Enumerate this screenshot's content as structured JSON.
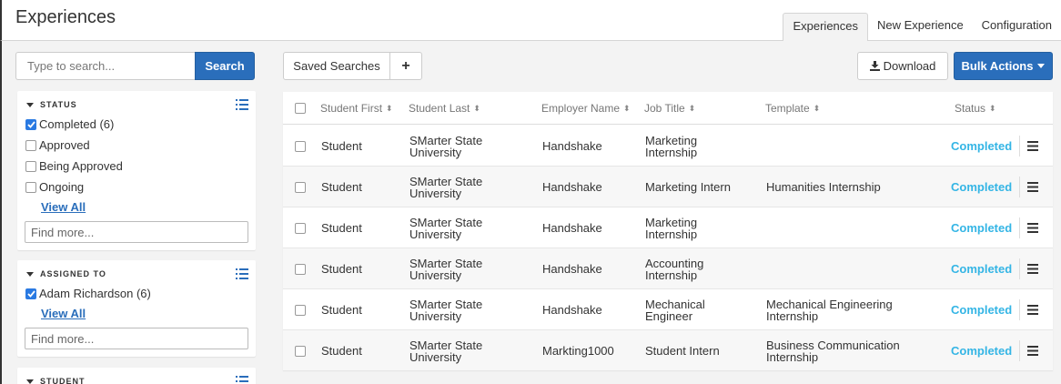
{
  "header": {
    "title": "Experiences",
    "tabs": [
      {
        "label": "Experiences",
        "active": true
      },
      {
        "label": "New Experience",
        "active": false
      },
      {
        "label": "Configuration",
        "active": false
      }
    ]
  },
  "sidebar": {
    "search_placeholder": "Type to search...",
    "search_button": "Search",
    "status": {
      "heading": "STATUS",
      "options": [
        {
          "label": "Completed (6)",
          "checked": true
        },
        {
          "label": "Approved",
          "checked": false
        },
        {
          "label": "Being Approved",
          "checked": false
        },
        {
          "label": "Ongoing",
          "checked": false
        }
      ],
      "view_all": "View All",
      "find_placeholder": "Find more..."
    },
    "assigned_to": {
      "heading": "ASSIGNED TO",
      "options": [
        {
          "label": "Adam Richardson (6)",
          "checked": true
        }
      ],
      "view_all": "View All",
      "find_placeholder": "Find more..."
    },
    "student": {
      "heading": "STUDENT"
    }
  },
  "toolbar": {
    "saved_searches": "Saved Searches",
    "add": "+",
    "download": "Download",
    "bulk_actions": "Bulk Actions"
  },
  "table": {
    "columns": [
      "Student First",
      "Student Last",
      "Employer Name",
      "Job Title",
      "Template",
      "Status"
    ],
    "rows": [
      {
        "first": "Student",
        "last": "SMarter State University",
        "employer": "Handshake",
        "job": "Marketing Internship",
        "template": "",
        "status": "Completed"
      },
      {
        "first": "Student",
        "last": "SMarter State University",
        "employer": "Handshake",
        "job": "Marketing Intern",
        "template": "Humanities Internship",
        "status": "Completed"
      },
      {
        "first": "Student",
        "last": "SMarter State University",
        "employer": "Handshake",
        "job": "Marketing Internship",
        "template": "",
        "status": "Completed"
      },
      {
        "first": "Student",
        "last": "SMarter State University",
        "employer": "Handshake",
        "job": "Accounting Internship",
        "template": "",
        "status": "Completed"
      },
      {
        "first": "Student",
        "last": "SMarter State University",
        "employer": "Handshake",
        "job": "Mechanical Engineer",
        "template": "Mechanical Engineering Internship",
        "status": "Completed"
      },
      {
        "first": "Student",
        "last": "SMarter State University",
        "employer": "Markting1000",
        "job": "Student Intern",
        "template": "Business Communication Internship",
        "status": "Completed"
      }
    ]
  },
  "colors": {
    "primary": "#2a6ebb",
    "status_completed": "#34b5e5",
    "checkbox_checked": "#2a7ae2"
  }
}
